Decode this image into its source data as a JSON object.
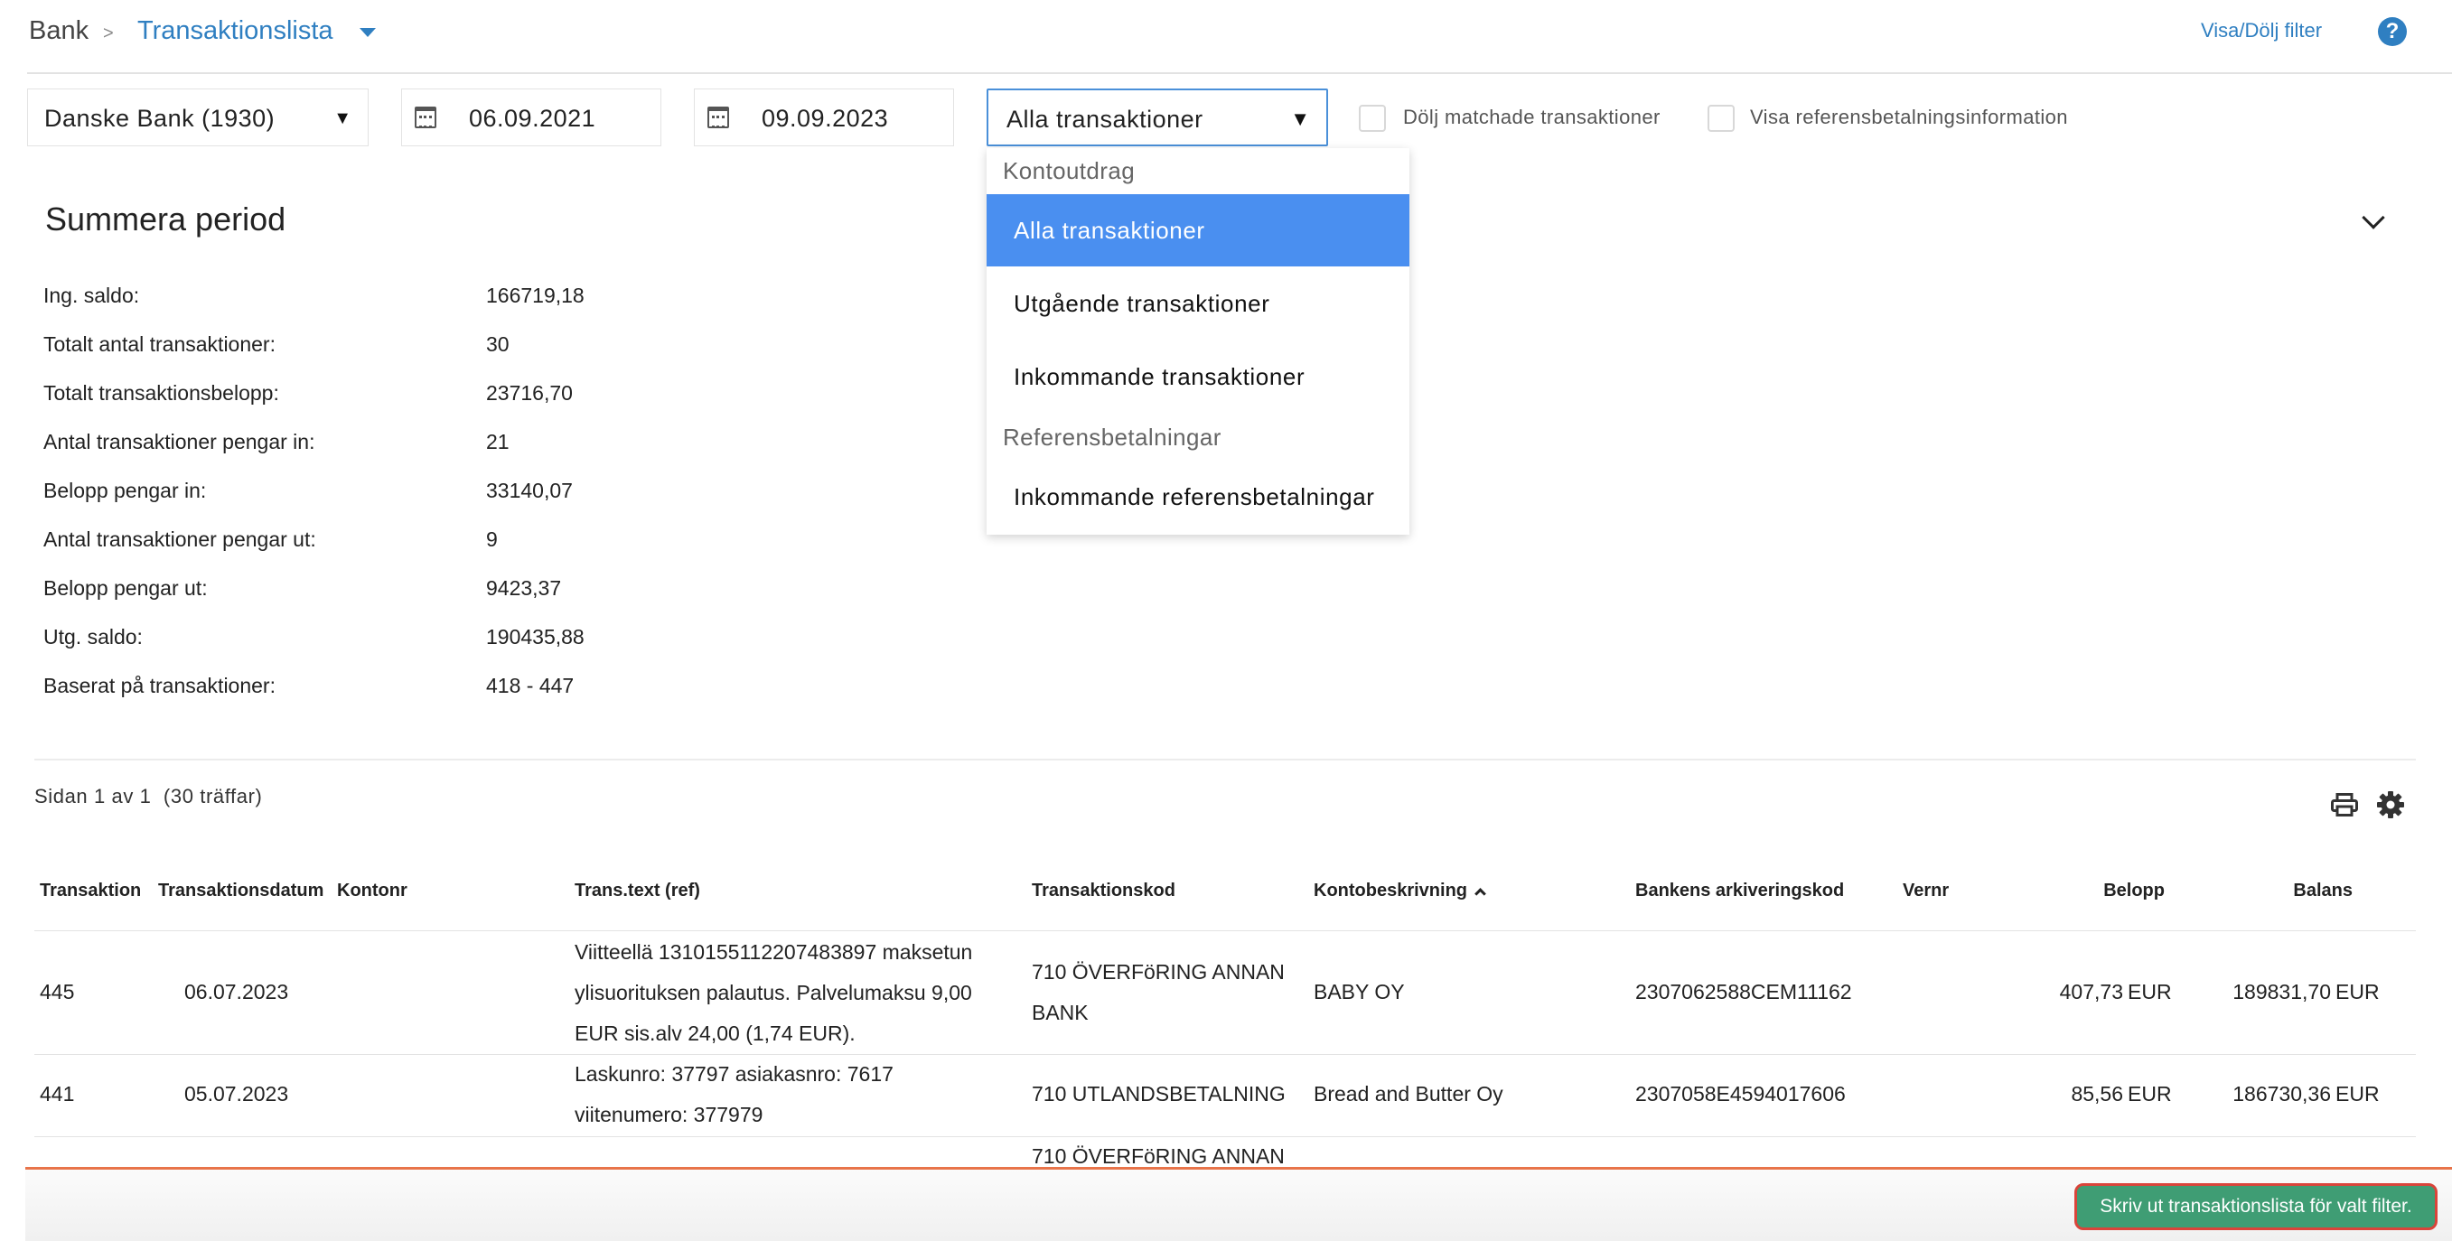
{
  "breadcrumb": {
    "root": "Bank",
    "separator": ">",
    "current": "Transaktionslista"
  },
  "header": {
    "toggle_filter": "Visa/Dölj filter",
    "help_label": "?"
  },
  "filters": {
    "bank_account": "Danske Bank (1930)",
    "date_from": "06.09.2021",
    "date_to": "09.09.2023",
    "transaction_type": "Alla transaktioner",
    "hide_matched_label": "Dölj matchade transaktioner",
    "show_reference_label": "Visa referensbetalningsinformation",
    "hide_matched_checked": false,
    "show_reference_checked": false
  },
  "dropdown": {
    "group1": "Kontoutdrag",
    "items1": [
      "Alla transaktioner",
      "Utgående transaktioner",
      "Inkommande transaktioner"
    ],
    "group2": "Referensbetalningar",
    "items2": [
      "Inkommande referensbetalningar"
    ],
    "selected": "Alla transaktioner"
  },
  "summary": {
    "title": "Summera period",
    "rows": [
      {
        "label": "Ing. saldo:",
        "value": "166719,18"
      },
      {
        "label": "Totalt antal transaktioner:",
        "value": "30"
      },
      {
        "label": "Totalt transaktionsbelopp:",
        "value": "23716,70"
      },
      {
        "label": "Antal transaktioner pengar in:",
        "value": "21"
      },
      {
        "label": "Belopp pengar in:",
        "value": "33140,07"
      },
      {
        "label": "Antal transaktioner pengar ut:",
        "value": "9"
      },
      {
        "label": "Belopp pengar ut:",
        "value": "9423,37"
      },
      {
        "label": "Utg. saldo:",
        "value": "190435,88"
      },
      {
        "label": "Baserat på transaktioner:",
        "value": "418 - 447"
      }
    ]
  },
  "pagination": {
    "info": "Sidan 1 av 1  (30 träffar)"
  },
  "table": {
    "columns": [
      "Transaktion",
      "Transaktionsdatum",
      "Kontonr",
      "Trans.text (ref)",
      "Transaktionskod",
      "Kontobeskrivning",
      "Bankens arkiveringskod",
      "Vernr",
      "Belopp",
      "Balans"
    ],
    "rows": [
      {
        "id": "445",
        "date": "06.07.2023",
        "account": "",
        "text": [
          "Viitteellä 1310155112207483897 maksetun",
          "ylisuorituksen palautus. Palvelumaksu 9,00",
          "EUR sis.alv 24,00 (1,74 EUR)."
        ],
        "code": [
          "710 ÖVERFöRING ANNAN",
          "BANK"
        ],
        "description": "BABY OY",
        "archive": "2307062588CEM11162",
        "vernr": "",
        "amount": "407,73",
        "amount_currency": "EUR",
        "balance": "189831,70",
        "balance_currency": "EUR"
      },
      {
        "id": "441",
        "date": "05.07.2023",
        "account": "",
        "text": [
          "Laskunro: 37797 asiakasnro: 7617",
          "viitenumero: 377979"
        ],
        "code": [
          "710 UTLANDSBETALNING"
        ],
        "description": "Bread and Butter Oy",
        "archive": "2307058E4594017606",
        "vernr": "",
        "amount": "85,56",
        "amount_currency": "EUR",
        "balance": "186730,36",
        "balance_currency": "EUR"
      }
    ],
    "partial_row_code": "710 ÖVERFöRING ANNAN"
  },
  "footer": {
    "print_button": "Skriv ut transaktionslista för valt filter."
  },
  "colors": {
    "accent": "#2f7fc1",
    "selection": "#4a8ff0",
    "print_button": "#3f9d74",
    "footer_line": "#e8744a"
  }
}
